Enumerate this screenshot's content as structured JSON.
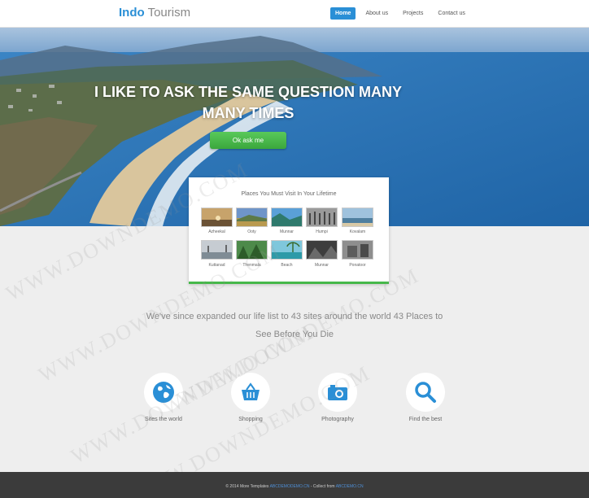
{
  "header": {
    "logo_bold": "Indo",
    "logo_light": "Tourism",
    "nav": [
      {
        "label": "Home",
        "active": true
      },
      {
        "label": "About us"
      },
      {
        "label": "Projects"
      },
      {
        "label": "Contact us"
      }
    ]
  },
  "hero": {
    "title": "I LIKE TO ASK THE SAME QUESTION MANY MANY TIMES",
    "cta": "Ok ask me"
  },
  "places": {
    "title": "Places You Must Visit In Your Lifetime",
    "items": [
      {
        "label": "Azheekal"
      },
      {
        "label": "Ooty"
      },
      {
        "label": "Munnar"
      },
      {
        "label": "Humpi"
      },
      {
        "label": "Kovalam"
      },
      {
        "label": "Kuttanad"
      },
      {
        "label": "Thenmala"
      },
      {
        "label": "Beach"
      },
      {
        "label": "Munnar"
      },
      {
        "label": "Ponatoor"
      }
    ]
  },
  "tagline": "We've since expanded our life list to 43 sites around the world 43 Places to See Before You Die",
  "features": [
    {
      "label": "Sites the world",
      "icon": "globe-icon"
    },
    {
      "label": "Shopping",
      "icon": "basket-icon"
    },
    {
      "label": "Photography",
      "icon": "camera-icon"
    },
    {
      "label": "Find the best",
      "icon": "search-icon"
    }
  ],
  "footer": {
    "prefix": "© 2014 More Templates",
    "link1": "ABCDEMODEMO.CN",
    "middle": "- Collect from",
    "link2": "ABCDEMO.CN"
  },
  "watermark": "WWW.DOWNDEMO.COM",
  "colors": {
    "accent": "#2a8fd6",
    "cta": "#46b84a",
    "footer": "#3b3b3b"
  }
}
